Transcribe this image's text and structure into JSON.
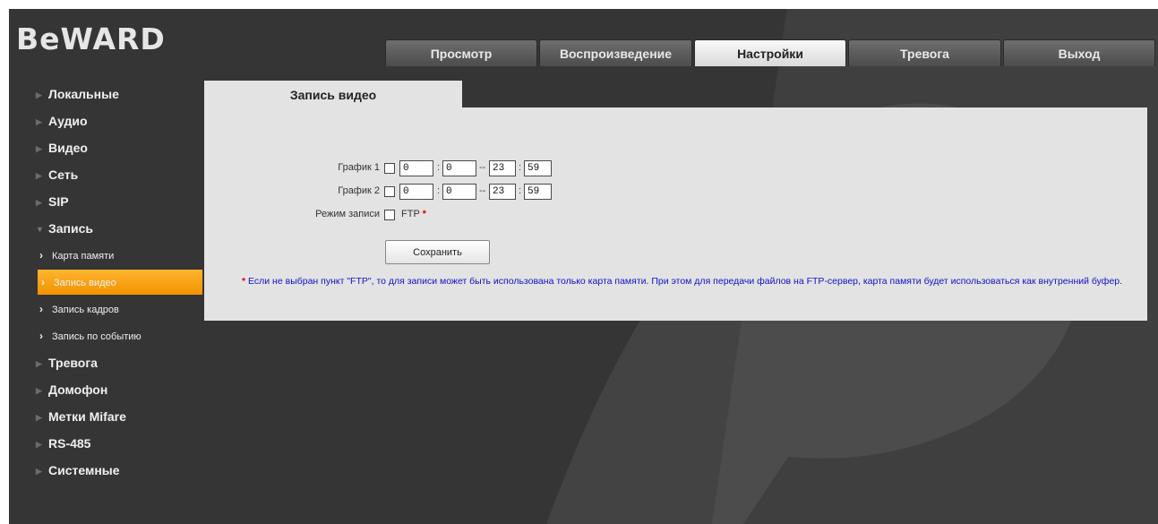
{
  "brand": {
    "logo": "BeWARD"
  },
  "topnav": {
    "tabs": [
      {
        "label": "Просмотр",
        "active": false
      },
      {
        "label": "Воспроизведение",
        "active": false
      },
      {
        "label": "Настройки",
        "active": true
      },
      {
        "label": "Тревога",
        "active": false
      },
      {
        "label": "Выход",
        "active": false
      }
    ]
  },
  "sidebar": {
    "items": [
      {
        "label": "Локальные"
      },
      {
        "label": "Аудио"
      },
      {
        "label": "Видео"
      },
      {
        "label": "Сеть"
      },
      {
        "label": "SIP"
      },
      {
        "label": "Запись",
        "expanded": true
      },
      {
        "label": "Тревога"
      },
      {
        "label": "Домофон"
      },
      {
        "label": "Метки Mifare"
      },
      {
        "label": "RS-485"
      },
      {
        "label": "Системные"
      }
    ],
    "subitems": [
      {
        "label": "Карта памяти",
        "active": false
      },
      {
        "label": "Запись видео",
        "active": true
      },
      {
        "label": "Запись кадров",
        "active": false
      },
      {
        "label": "Запись по событию",
        "active": false
      }
    ]
  },
  "page": {
    "section_title": "Запись видео",
    "schedule1": {
      "label": "График 1",
      "from_h": "0",
      "from_m": "0",
      "to_h": "23",
      "to_m": "59"
    },
    "schedule2": {
      "label": "График 2",
      "from_h": "0",
      "from_m": "0",
      "to_h": "23",
      "to_m": "59"
    },
    "mode": {
      "label": "Режим записи",
      "option": "FTP",
      "required_mark": "*"
    },
    "time_sep": ":",
    "range_sep": "--",
    "save_label": "Сохранить",
    "note": {
      "star": "*",
      "text": "Если не выбран пункт \"FTP\", то для записи может быть использована только карта памяти. При этом для передачи файлов на FTP-сервер, карта памяти будет использоваться как внутренний буфер."
    }
  },
  "colors": {
    "background": "#353535",
    "panel": "#e3e3e3",
    "active_submenu": "#f29300",
    "note_text": "#1111cc",
    "required": "#e00000"
  }
}
